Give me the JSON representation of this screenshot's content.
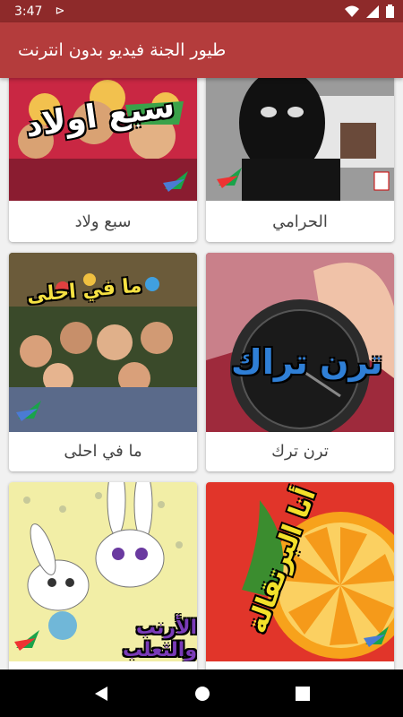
{
  "status": {
    "time": "3:47"
  },
  "app": {
    "title": "طيور الجنة فيديو بدون انترنت"
  },
  "videos": [
    {
      "title": "الحرامي"
    },
    {
      "title": "سبع ولاد",
      "thumb_text": "سبع اولاد"
    },
    {
      "title": "ترن ترك",
      "thumb_text": "ترن تراك"
    },
    {
      "title": "ما في احلى",
      "thumb_text": "ما في احلى"
    },
    {
      "title": "",
      "thumb_text": "أنا البرتقالة"
    },
    {
      "title": "",
      "thumb_text": "الأرنب والثعلب"
    }
  ],
  "colors": {
    "status_bar": "#8e2a2a",
    "app_bar": "#b43c3c",
    "nav_bar": "#000000"
  }
}
